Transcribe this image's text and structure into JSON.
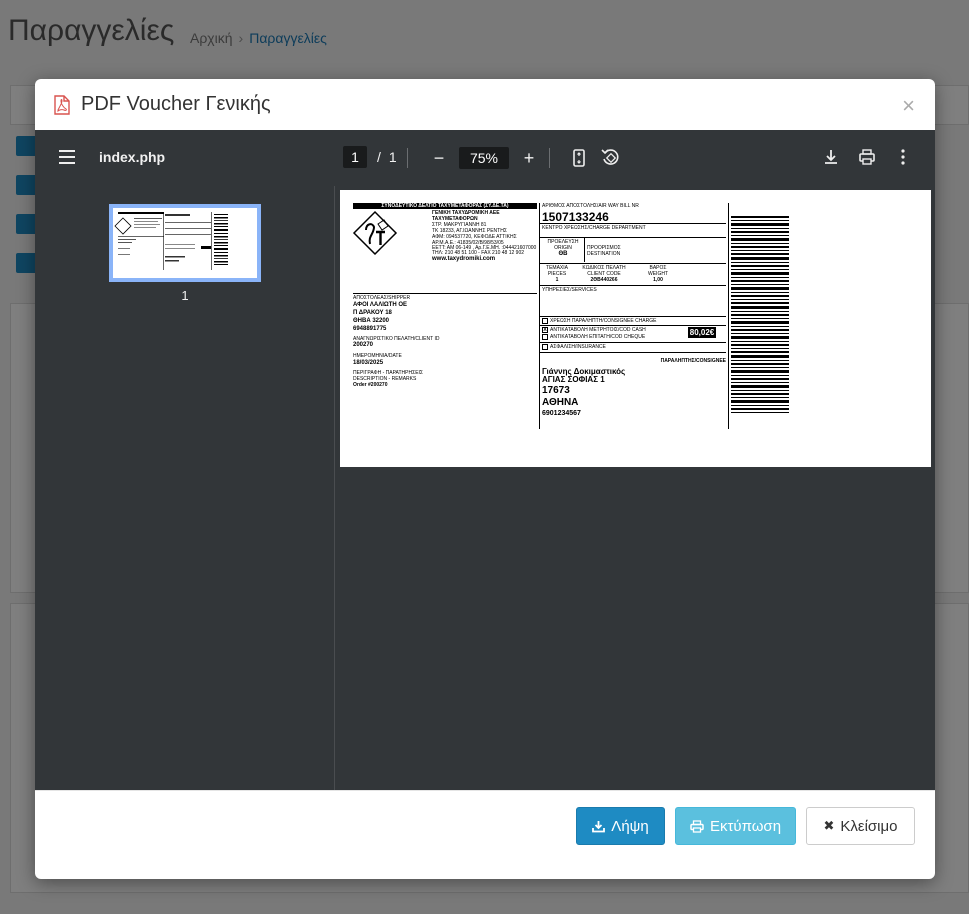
{
  "background": {
    "page_title": "Παραγγελίες",
    "breadcrumb_home": "Αρχική",
    "breadcrumb_separator": "›",
    "breadcrumb_current": "Παραγγελίες"
  },
  "modal": {
    "title": "PDF Voucher Γενικής",
    "close_glyph": "×"
  },
  "viewer": {
    "filename": "index.php",
    "current_page": "1",
    "page_separator": "/",
    "total_pages": "1",
    "zoom": "75%",
    "thumbnail_number": "1"
  },
  "voucher": {
    "doc_header": "ΣΥΝΟΔΕΥΤΙΚΟ ΔΕΛΤΙΟ ΤΑΧΥΜΕΤΑΦΟΡΑΣ (ΣΥ.ΔΕ.ΤΑ)",
    "company_name_1": "ΓΕΝΙΚΗ ΤΑΧΥΔΡΟΜΙΚΗ ΑΕΕ",
    "company_name_2": "ΤΑΧΥΜΕΤΑΦΟΡΩΝ",
    "company_addr_1": "ΣΤΡ. ΜΑΚΡΥΓΙΑΝΝΗ 81",
    "company_addr_2": "ΤΚ 18233, ΑΓ.ΙΩΑΝΝΗΣ ΡΕΝΤΗΣ",
    "company_afm": "ΑΦΜ: 094537720, ΚΕΦΟΔΕ ΑΤΤΙΚΗΣ",
    "company_ame": "ΑΡ.Μ.Α.Ε.: 41835/02/Β/98/53/05",
    "company_gemi": "ΕΕΤΤ: ΑΜ 06-149 , Αρ.Γ.Ε.ΜΗ. :044421607000",
    "company_tel": "ΤΗΛ: 210 48 51 100 - FAX 210 48 12 902",
    "company_web": "www.taxydromiki.com",
    "shipper_label": "ΑΠΟΣΤΟΛΕΑΣ/SHIPPER",
    "shipper_name": "ΑΦΟΙ ΛΑΛΙΩΤΗ ΟΕ",
    "shipper_addr": "Π ΔΡΑΚΟΥ 18",
    "shipper_city": "ΘΗΒΑ 32200",
    "shipper_phone": "6948891775",
    "client_id_label": "ΑΝΑΓΝΩΡΙΣΤΙΚΟ ΠΕΛΑΤΗ/CLIENT ID",
    "client_id": "200270",
    "date_label": "ΗΜΕΡΟΜΗΝΙΑ/DATE",
    "date": "18/03/2025",
    "remarks_label_1": "ΠΕΡΙΓΡΑΦΗ - ΠΑΡΑΤΗΡΗΣΕΙΣ",
    "remarks_label_2": "DESCRIPTION - REMARKS",
    "remarks": "Order #200270",
    "awb_label": "ΑΡΙΘΜΟΣ ΑΠΟΣΤΟΛΗΣ/AIR WAY BILL NR",
    "awb": "1507133246",
    "charge_dept_label": "ΚΕΝΤΡΟ ΧΡΕΩΣΗΣ/CHARGE DEPARTMENT",
    "origin_label_1": "ΠΡΟΕΛΕΥΣΗ",
    "origin_label_2": "ORIGIN",
    "origin": "ΘΒ",
    "dest_label_1": "ΠΡΟΟΡΙΣΜΟΣ",
    "dest_label_2": "DESTINATION",
    "pieces_label_1": "ΤΕΜΑΧΙΑ",
    "pieces_label_2": "PIECES",
    "pieces": "1",
    "client_code_label_1": "ΚΩΔΙΚΟΣ ΠΕΛΑΤΗ",
    "client_code_label_2": "CLIENT CODE",
    "client_code": "2ΘΒ440266",
    "weight_label_1": "ΒΑΡΟΣ",
    "weight_label_2": "WEIGHT",
    "weight": "1,00",
    "services_label": "ΥΠΗΡΕΣΙΕΣ/SERVICES",
    "svc_consignee_charge": "ΧΡΕΩΣΗ ΠΑΡΑΛΗΠΤΗ/CONSIGNEE CHARGE",
    "svc_cod_cash": "ΑΝΤΙΚΑΤΑΒΟΛΗ ΜΕΤΡΗΤΟΙΣ/COD CASH",
    "svc_cod_cheque": "ΑΝΤΙΚΑΤΑΒΟΛΗ ΕΠΙΤΑΓΗ/COD CHEQUE",
    "svc_insurance": "ΑΣΦΑΛΙΣΗ/INSURANCE",
    "cod_mark": "X",
    "cod_amount": "80,02€",
    "consignee_label": "ΠΑΡΑΛΗΠΤΗΣ/CONSIGNEE",
    "consignee_name": "Γιάννης Δοκιμαστικός",
    "consignee_addr": "ΑΓΙΑΣ ΣΟΦΙΑΣ 1",
    "consignee_zip": "17673",
    "consignee_city": "ΑΘΗΝΑ",
    "consignee_phone": "6901234567"
  },
  "footer": {
    "download_label": "Λήψη",
    "print_label": "Εκτύπωση",
    "close_label": "Κλείσιμο"
  },
  "colors": {
    "primary": "#1e8bc3",
    "info": "#5bc0de",
    "viewer_bg": "#323639",
    "thumb_highlight": "#8ab4f8"
  }
}
